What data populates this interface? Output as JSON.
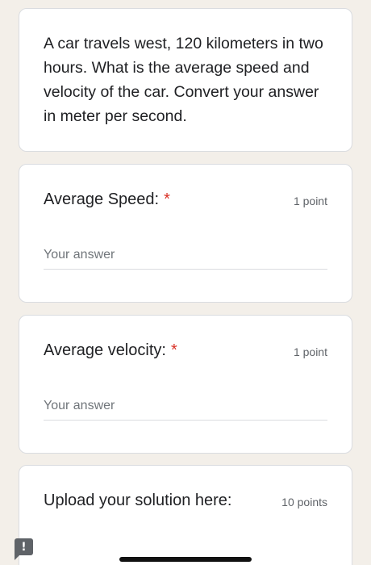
{
  "description": {
    "text": "A car travels west, 120 kilometers in two hours. What is the average speed and velocity of the car. Convert your answer in meter per second."
  },
  "questions": [
    {
      "title": "Average Speed:",
      "required_mark": "*",
      "points": "1 point",
      "placeholder": "Your answer"
    },
    {
      "title": "Average velocity:",
      "required_mark": "*",
      "points": "1 point",
      "placeholder": "Your answer"
    },
    {
      "title": "Upload your solution here:",
      "points": "10 points"
    }
  ],
  "report_button": {
    "icon": "exclamation-icon",
    "glyph": "!"
  },
  "colors": {
    "background": "#f3efe9",
    "card": "#ffffff",
    "required": "#d93025",
    "text": "#202124",
    "muted": "#5f6368"
  }
}
